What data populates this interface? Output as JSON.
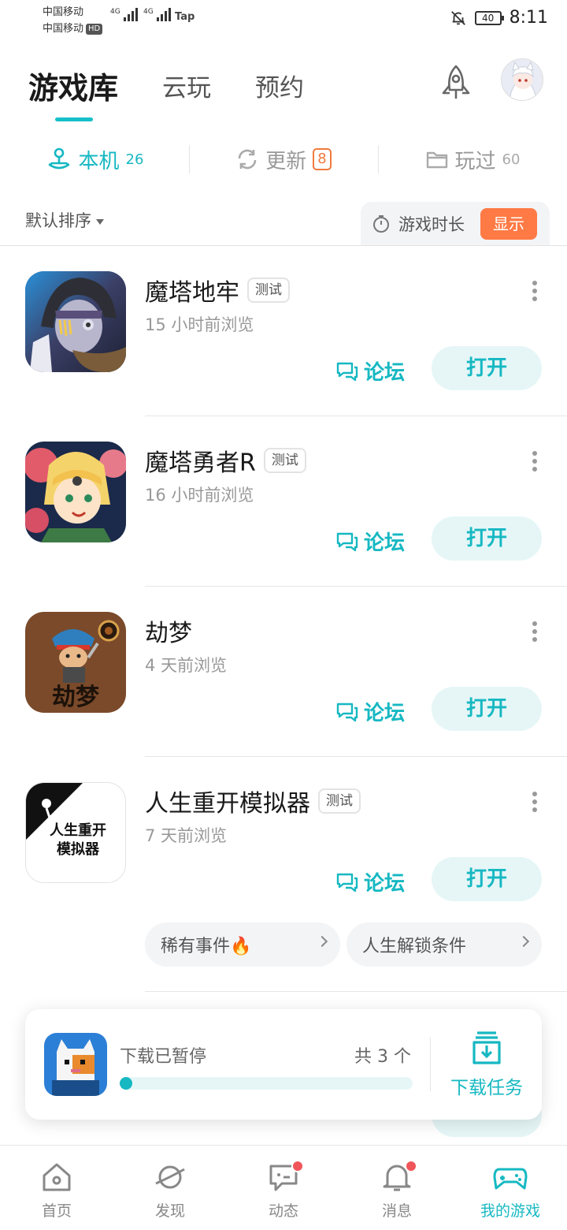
{
  "status_bar": {
    "carrier1": "中国移动",
    "carrier2": "中国移动",
    "hd": "HD",
    "net1": "4G",
    "net2": "4G",
    "tap": "Tap",
    "battery": "40",
    "time": "8:11"
  },
  "header": {
    "tabs": [
      {
        "label": "游戏库"
      },
      {
        "label": "云玩"
      },
      {
        "label": "预约"
      }
    ]
  },
  "sub_tabs": [
    {
      "label": "本机",
      "count": "26"
    },
    {
      "label": "更新",
      "count": "8"
    },
    {
      "label": "玩过",
      "count": "60"
    }
  ],
  "toolbar": {
    "sort_label": "默认排序",
    "playtime_label": "游戏时长",
    "show_label": "显示"
  },
  "games": [
    {
      "name": "魔塔地牢",
      "tag": "测试",
      "time": "15 小时前浏览",
      "forum": "论坛",
      "open": "打开"
    },
    {
      "name": "魔塔勇者R",
      "tag": "测试",
      "time": "16 小时前浏览",
      "forum": "论坛",
      "open": "打开"
    },
    {
      "name": "劫梦",
      "tag": "",
      "time": "4 天前浏览",
      "forum": "论坛",
      "open": "打开",
      "icon_text": "劫梦"
    },
    {
      "name": "人生重开模拟器",
      "tag": "测试",
      "time": "7 天前浏览",
      "forum": "论坛",
      "open": "打开",
      "icon_text": "人生重开\n模拟器",
      "chips": [
        {
          "label": "稀有事件🔥"
        },
        {
          "label": "人生解锁条件"
        }
      ]
    }
  ],
  "download": {
    "status": "下载已暂停",
    "count": "共 3 个",
    "progress": 0.02,
    "task_label": "下载任务"
  },
  "bottom_nav": [
    {
      "label": "首页"
    },
    {
      "label": "发现"
    },
    {
      "label": "动态"
    },
    {
      "label": "消息"
    },
    {
      "label": "我的游戏"
    }
  ],
  "colors": {
    "accent": "#16b8c2",
    "badge": "#f07a3c",
    "show_button": "#ff7a45",
    "dot": "#f0555a"
  }
}
